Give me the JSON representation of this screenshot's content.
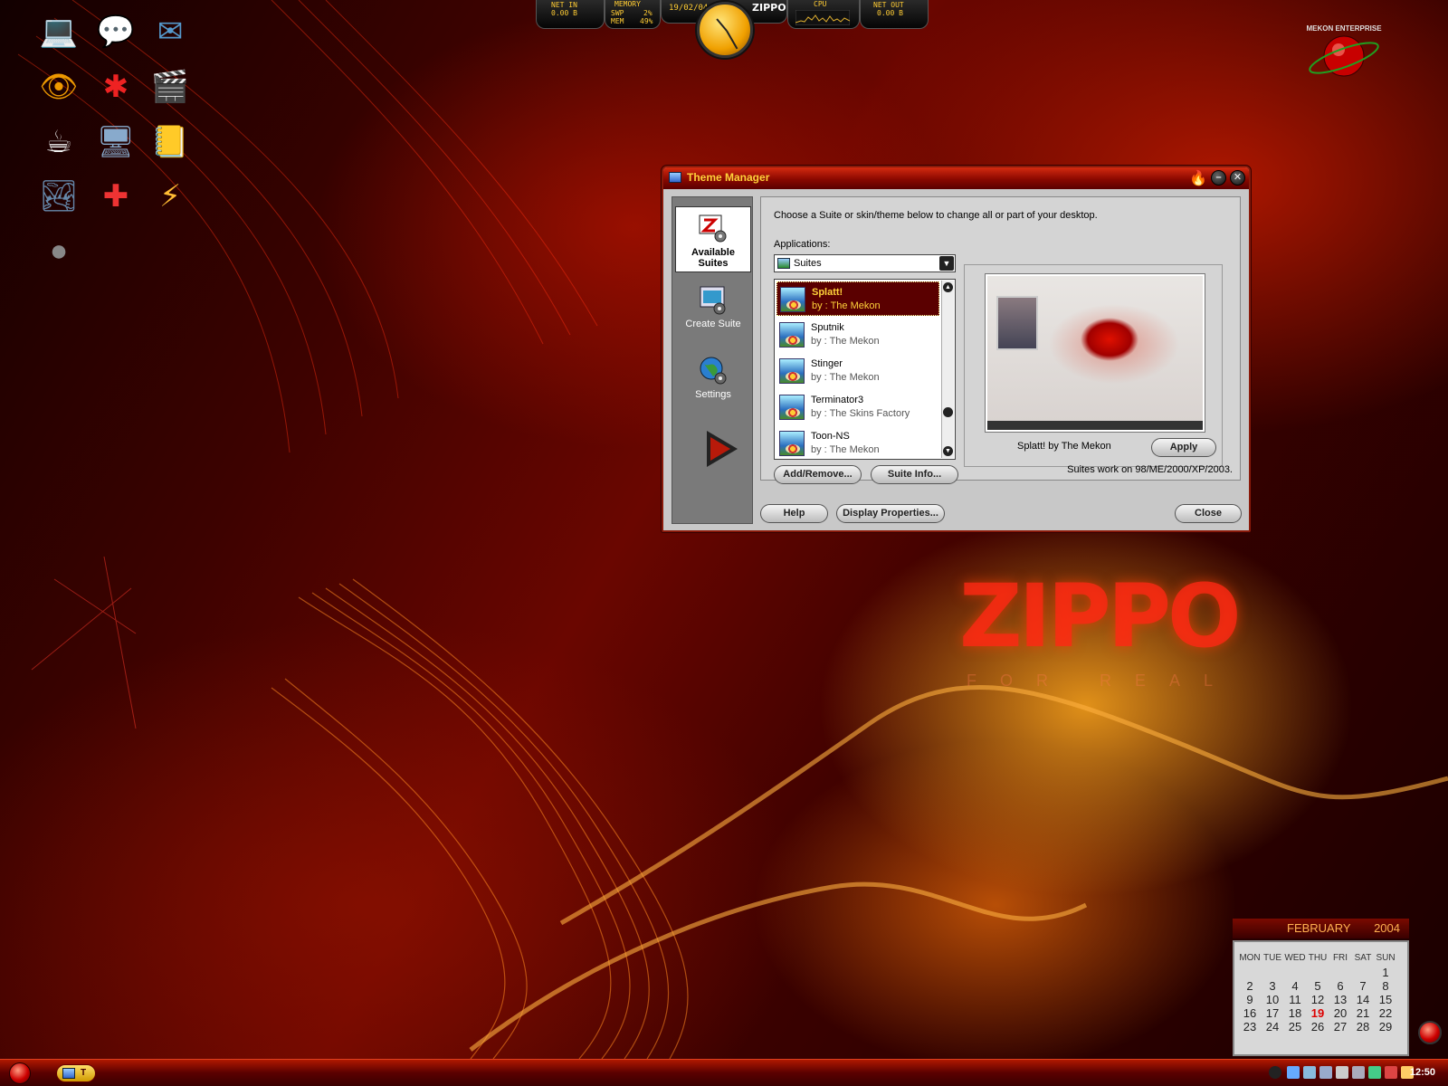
{
  "desktop": {
    "icons": [
      {
        "name": "laptop-icon",
        "glyph": "💻"
      },
      {
        "name": "chat-bubble-icon",
        "glyph": "💬"
      },
      {
        "name": "stamp-icon",
        "glyph": "✉"
      },
      {
        "name": "eye-icon",
        "glyph": "👁"
      },
      {
        "name": "splat-icon",
        "glyph": "✱"
      },
      {
        "name": "film-folder-icon",
        "glyph": "🎬"
      },
      {
        "name": "coffee-cup-icon",
        "glyph": "☕"
      },
      {
        "name": "monitor-icon",
        "glyph": "🖥"
      },
      {
        "name": "notepad-icon",
        "glyph": "📒"
      },
      {
        "name": "landscape-icon",
        "glyph": "🏞"
      },
      {
        "name": "lifebuoy-icon",
        "glyph": "✚"
      },
      {
        "name": "lightning-icon",
        "glyph": "⚡"
      },
      {
        "name": "sphere-icon",
        "glyph": "●"
      }
    ]
  },
  "sysmon": {
    "net_in_label": "NET IN",
    "net_in_value": "0.00 B",
    "memory_label": "MEMORY",
    "swp_label": "SWP",
    "swp_value": "2%",
    "mem_label": "MEM",
    "mem_value": "49%",
    "date": "19/02/04",
    "brand": "ZIPPO",
    "cpu_label": "CPU",
    "net_out_label": "NET OUT",
    "net_out_value": "0.00 B"
  },
  "dialog": {
    "title": "Theme Manager",
    "sidebar": {
      "items": [
        {
          "label": "Available Suites"
        },
        {
          "label": "Create Suite"
        },
        {
          "label": "Settings"
        }
      ]
    },
    "instruction": "Choose a Suite or skin/theme below to change all or part of your desktop.",
    "applications_label": "Applications:",
    "applications_value": "Suites",
    "suites": [
      {
        "name": "Splatt!",
        "author": "by : The Mekon"
      },
      {
        "name": "Sputnik",
        "author": "by : The Mekon"
      },
      {
        "name": "Stinger",
        "author": "by : The Mekon"
      },
      {
        "name": "Terminator3",
        "author": "by : The Skins Factory"
      },
      {
        "name": "Toon-NS",
        "author": "by : The Mekon"
      }
    ],
    "preview_caption": "Splatt! by The Mekon",
    "apply_label": "Apply",
    "add_remove_label": "Add/Remove...",
    "suite_info_label": "Suite Info...",
    "compat_note": "Suites work on 98/ME/2000/XP/2003.",
    "help_label": "Help",
    "display_props_label": "Display Properties...",
    "close_label": "Close"
  },
  "wallpaper": {
    "logo": "ZIPPO",
    "tagline": "FOR REAL",
    "badge": "MEKON ENTERPRISE"
  },
  "calendar": {
    "month": "FEBRUARY",
    "year": "2004",
    "day_headers": [
      "MON",
      "TUE",
      "WED",
      "THU",
      "FRI",
      "SAT",
      "SUN"
    ],
    "first_weekday_index": 6,
    "days_in_month": 29,
    "today": 19
  },
  "taskbar": {
    "task_label": "T",
    "time": "12:50"
  },
  "colors": {
    "accent": "#ffd23a",
    "selection": "#5a0000",
    "today": "#dd0000"
  }
}
